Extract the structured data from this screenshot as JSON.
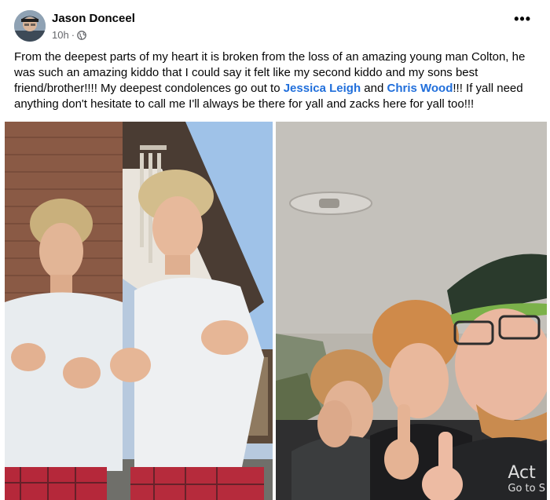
{
  "post": {
    "author": "Jason Donceel",
    "time": "10h",
    "separator": "·",
    "privacy_icon": "globe-icon",
    "more_icon": "more-options-icon",
    "more_label": "•••",
    "text_part1": "From the deepest parts of my heart it is broken from the loss of an amazing young man Colton, he was such an amazing kiddo that I could say it felt like my second kiddo and my sons best friend/brother!!!! My deepest condolences go out to ",
    "mention1": "Jessica Leigh",
    "text_and": " and ",
    "mention2": "Chris Wood",
    "text_part2": "!!! If yall need anything don't hesitate to call me I'll always be there for yall and zacks here for yall too!!!"
  },
  "photos": {
    "watermark_line1": "Act",
    "watermark_line2": "Go to S"
  },
  "colors": {
    "mention": "#216fdb",
    "meta": "#65676b",
    "text": "#050505"
  }
}
